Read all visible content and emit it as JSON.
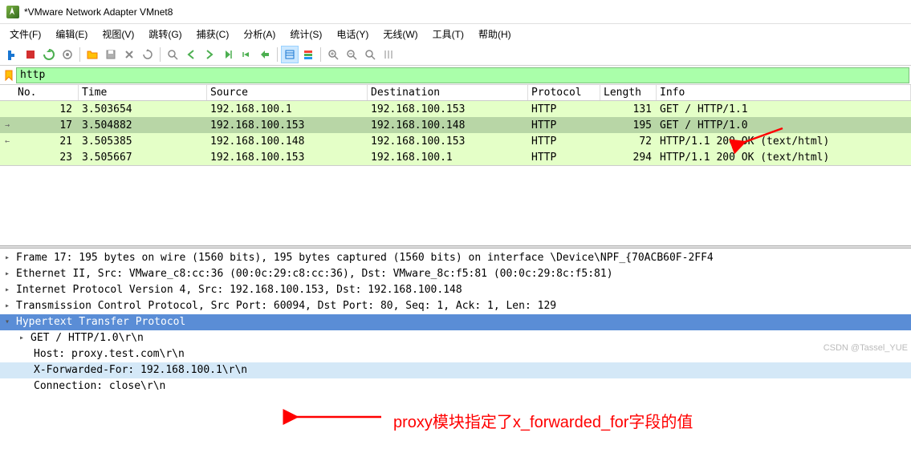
{
  "window": {
    "title": "*VMware Network Adapter VMnet8"
  },
  "menu": {
    "file": "文件(F)",
    "edit": "编辑(E)",
    "view": "视图(V)",
    "go": "跳转(G)",
    "capture": "捕获(C)",
    "analyze": "分析(A)",
    "stats": "统计(S)",
    "telephony": "电话(Y)",
    "wireless": "无线(W)",
    "tools": "工具(T)",
    "help": "帮助(H)"
  },
  "filter": {
    "value": "http"
  },
  "columns": {
    "no": "No.",
    "time": "Time",
    "src": "Source",
    "dst": "Destination",
    "proto": "Protocol",
    "len": "Length",
    "info": "Info"
  },
  "packets": [
    {
      "no": "12",
      "time": "3.503654",
      "src": "192.168.100.1",
      "dst": "192.168.100.153",
      "proto": "HTTP",
      "len": "131",
      "info": "GET / HTTP/1.1",
      "cls": "green",
      "marker": ""
    },
    {
      "no": "17",
      "time": "3.504882",
      "src": "192.168.100.153",
      "dst": "192.168.100.148",
      "proto": "HTTP",
      "len": "195",
      "info": "GET / HTTP/1.0",
      "cls": "selected",
      "marker": "→"
    },
    {
      "no": "21",
      "time": "3.505385",
      "src": "192.168.100.148",
      "dst": "192.168.100.153",
      "proto": "HTTP",
      "len": "72",
      "info": "HTTP/1.1 200 OK  (text/html)",
      "cls": "green",
      "marker": "←"
    },
    {
      "no": "23",
      "time": "3.505667",
      "src": "192.168.100.153",
      "dst": "192.168.100.1",
      "proto": "HTTP",
      "len": "294",
      "info": "HTTP/1.1 200 OK  (text/html)",
      "cls": "green",
      "marker": ""
    }
  ],
  "detail": {
    "frame": "Frame 17: 195 bytes on wire (1560 bits), 195 bytes captured (1560 bits) on interface \\Device\\NPF_{70ACB60F-2FF4",
    "eth": "Ethernet II, Src: VMware_c8:cc:36 (00:0c:29:c8:cc:36), Dst: VMware_8c:f5:81 (00:0c:29:8c:f5:81)",
    "ip": "Internet Protocol Version 4, Src: 192.168.100.153, Dst: 192.168.100.148",
    "tcp": "Transmission Control Protocol, Src Port: 60094, Dst Port: 80, Seq: 1, Ack: 1, Len: 129",
    "http": "Hypertext Transfer Protocol",
    "get": "GET / HTTP/1.0\\r\\n",
    "host": "Host: proxy.test.com\\r\\n",
    "xff": "X-Forwarded-For: 192.168.100.1\\r\\n",
    "conn": "Connection: close\\r\\n"
  },
  "annotation": {
    "text": "proxy模块指定了x_forwarded_for字段的值"
  },
  "watermark": "CSDN @Tassel_YUE",
  "colors": {
    "arrow": "#ff0000",
    "filter_bg": "#aaffaa",
    "sel_row": "#b8d6a6",
    "hl_blue": "#5a8dd6"
  }
}
